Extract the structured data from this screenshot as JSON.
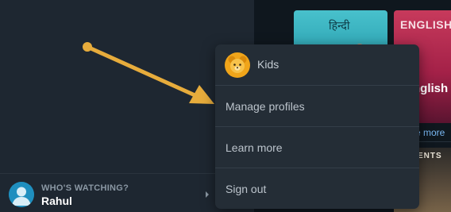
{
  "sidebar": {
    "profile": {
      "label": "WHO'S WATCHING?",
      "name": "Rahul"
    }
  },
  "content": {
    "tiles": [
      {
        "label": "हिन्दी"
      },
      {
        "label": "ENGLISH"
      },
      {
        "label": "ENTS"
      }
    ],
    "english_overlay": "nglish",
    "more_link": "e more"
  },
  "menu": {
    "items": [
      {
        "label": "Kids",
        "icon": "kids-bear-icon"
      },
      {
        "label": "Manage profiles"
      },
      {
        "label": "Learn more"
      },
      {
        "label": "Sign out"
      }
    ]
  },
  "colors": {
    "sidebar_bg": "#1e2731",
    "menu_bg": "#242d36",
    "arrow": "#e7ac3c",
    "avatar": "#1f8fbf",
    "kids_avatar": "#f0a51a"
  }
}
